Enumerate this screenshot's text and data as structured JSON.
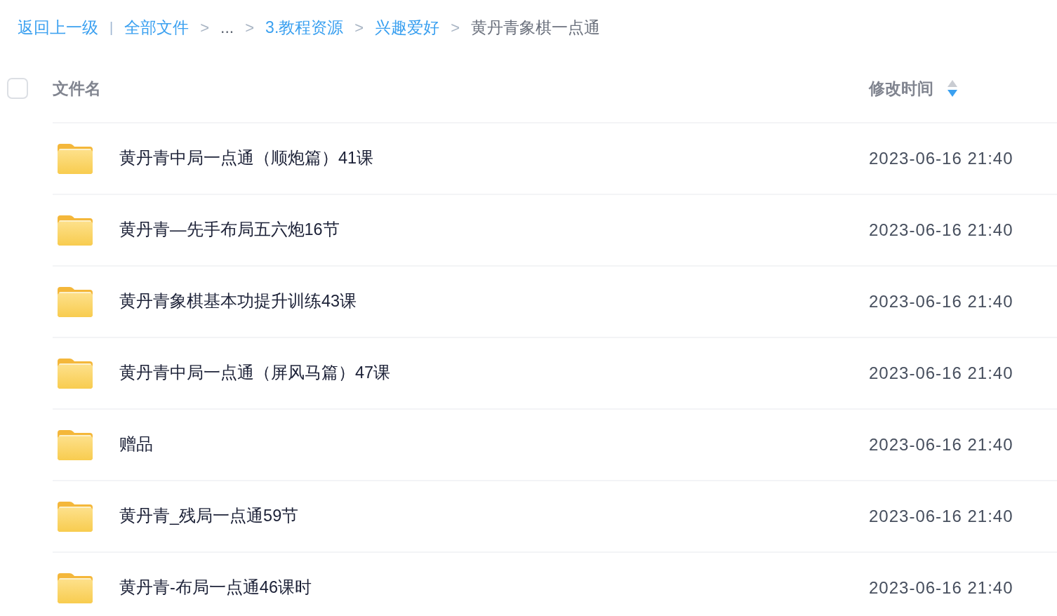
{
  "breadcrumb": {
    "back_link": "返回上一级",
    "divider": "|",
    "path": [
      {
        "label": "全部文件",
        "kind": "link"
      },
      {
        "separator": ">",
        "label": "...",
        "kind": "ellipsis"
      },
      {
        "separator": ">",
        "label": "3.教程资源",
        "kind": "link"
      },
      {
        "separator": ">",
        "label": "兴趣爱好",
        "kind": "link"
      },
      {
        "separator": ">",
        "label": "黄丹青象棋一点通",
        "kind": "current"
      }
    ]
  },
  "table": {
    "select_all": {
      "checked": false
    },
    "columns": [
      {
        "label": "文件名"
      },
      {
        "label": "修改时间",
        "sort_descending": true
      }
    ],
    "rows": [
      {
        "kind": "folder",
        "name": "黄丹青中局一点通（顺炮篇）41课",
        "modified": "2023-06-16 21:40"
      },
      {
        "kind": "folder",
        "name": "黄丹青—先手布局五六炮16节",
        "modified": "2023-06-16 21:40"
      },
      {
        "kind": "folder",
        "name": "黄丹青象棋基本功提升训练43课",
        "modified": "2023-06-16 21:40"
      },
      {
        "kind": "folder",
        "name": "黄丹青中局一点通（屏风马篇）47课",
        "modified": "2023-06-16 21:40"
      },
      {
        "kind": "folder",
        "name": "赠品",
        "modified": "2023-06-16 21:40"
      },
      {
        "kind": "folder",
        "name": "黄丹青_残局一点通59节",
        "modified": "2023-06-16 21:40"
      },
      {
        "kind": "folder",
        "name": "黄丹青-布局一点通46课时",
        "modified": "2023-06-16 21:40"
      }
    ]
  }
}
